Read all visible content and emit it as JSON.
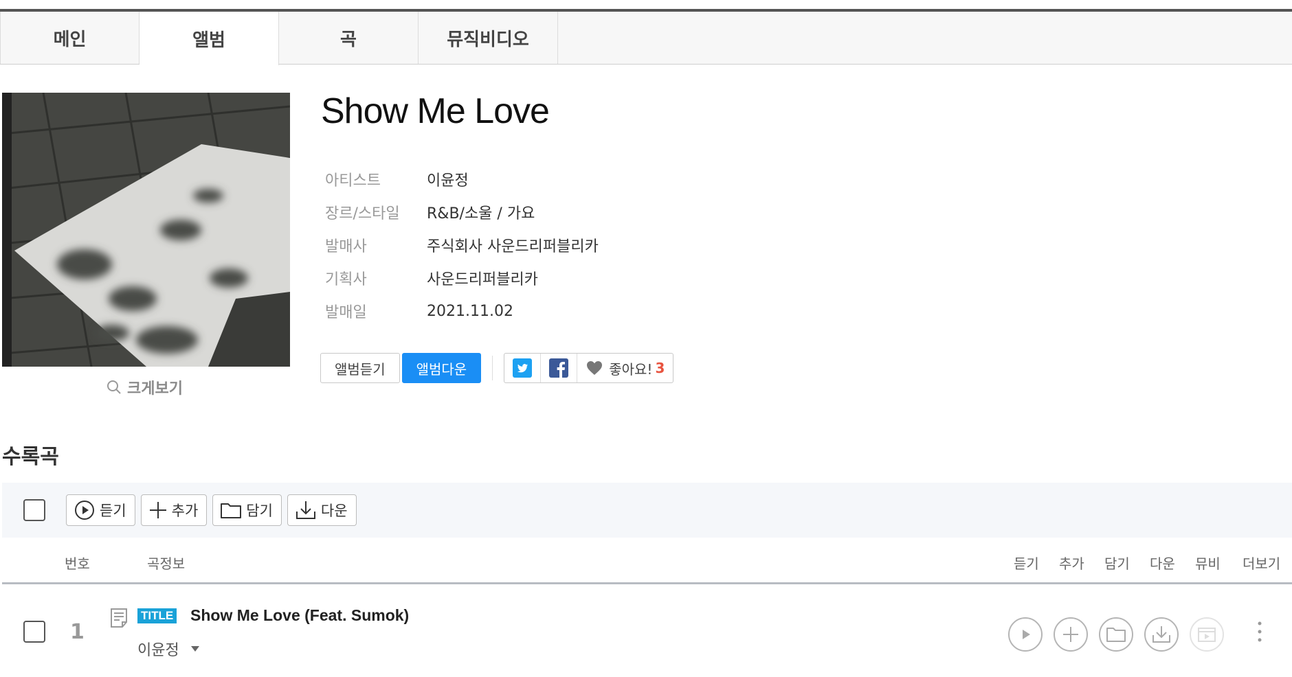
{
  "tabs": [
    "메인",
    "앨범",
    "곡",
    "뮤직비디오"
  ],
  "album": {
    "title": "Show Me Love",
    "zoom_label": "크게보기",
    "meta": [
      {
        "key": "아티스트",
        "value": "이윤정"
      },
      {
        "key": "장르/스타일",
        "value": "R&B/소울 / 가요"
      },
      {
        "key": "발매사",
        "value": "주식회사 사운드리퍼블리카"
      },
      {
        "key": "기획사",
        "value": "사운드리퍼블리카"
      },
      {
        "key": "발매일",
        "value": "2021.11.02"
      }
    ],
    "buttons": {
      "listen": "앨범듣기",
      "download": "앨범다운"
    },
    "like": {
      "label": "좋아요!",
      "count": "3"
    }
  },
  "tracklist": {
    "section_title": "수록곡",
    "toolbar": {
      "play": "듣기",
      "add": "추가",
      "save": "담기",
      "download": "다운"
    },
    "columns": {
      "number": "번호",
      "info": "곡정보",
      "play": "듣기",
      "add": "추가",
      "save": "담기",
      "download": "다운",
      "mv": "뮤비",
      "more": "더보기"
    },
    "tracks": [
      {
        "number": "1",
        "badge": "TITLE",
        "title": "Show Me Love (Feat. Sumok)",
        "artist": "이윤정"
      }
    ]
  },
  "colors": {
    "accent": "#1a8ef5",
    "title_badge": "#19a2d8",
    "like_count": "#e8533f"
  }
}
